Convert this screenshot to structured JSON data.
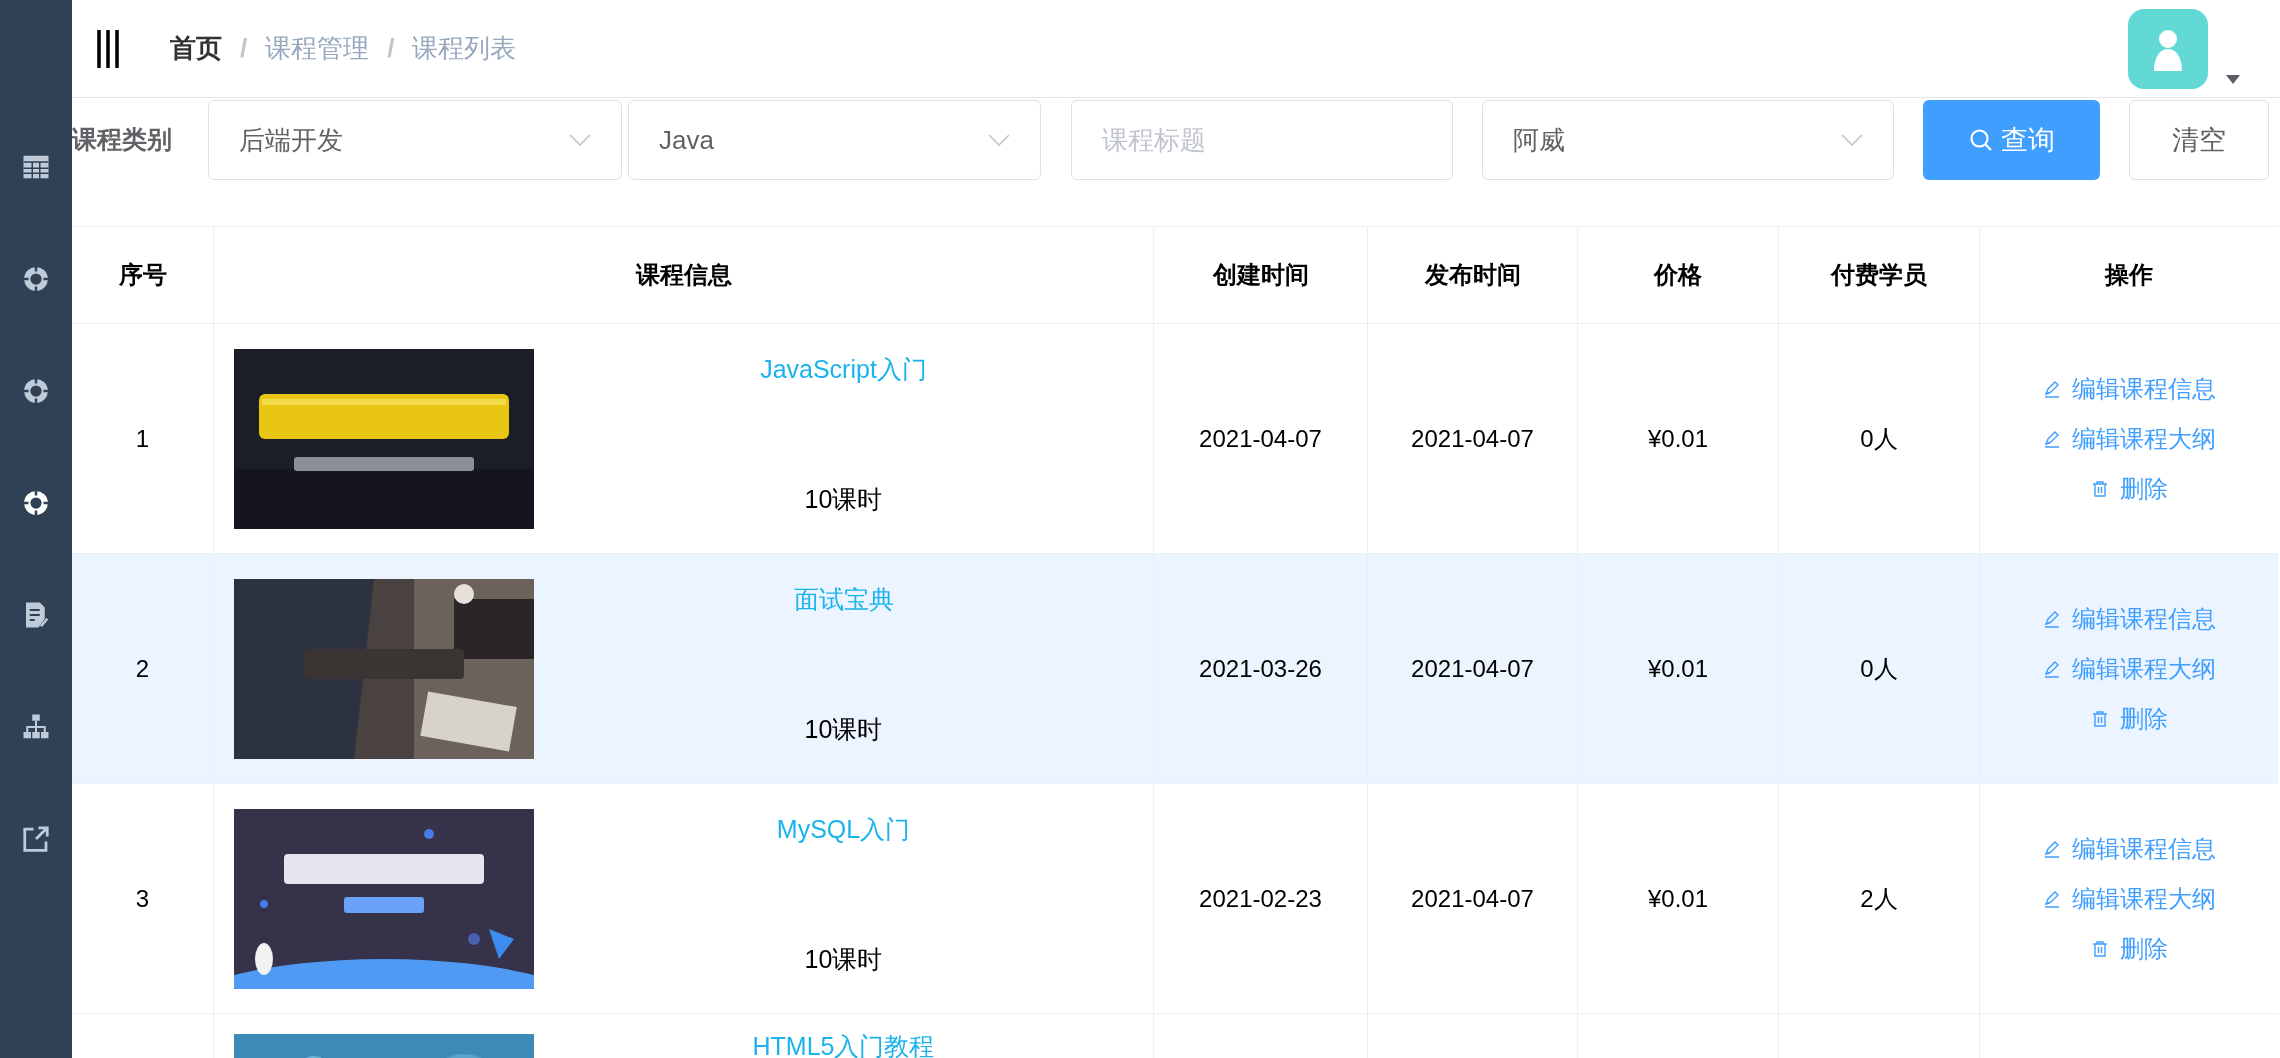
{
  "sidebar": {
    "items": [
      {
        "selected": false
      },
      {
        "selected": false
      },
      {
        "selected": false
      },
      {
        "selected": true
      },
      {
        "selected": false
      },
      {
        "selected": false
      },
      {
        "selected": false
      }
    ]
  },
  "breadcrumb": [
    {
      "label": "首页",
      "kind": "link"
    },
    {
      "separator": "/",
      "label": "课程管理",
      "kind": "text"
    },
    {
      "separator": "/",
      "label": "课程列表",
      "kind": "text"
    }
  ],
  "filters": {
    "label": "课程类别",
    "category": "后端开发",
    "subcategory": "Java",
    "title_placeholder": "课程标题",
    "teacher": "阿威",
    "search_button": "查询",
    "clear_button": "清空"
  },
  "table": {
    "columns": [
      "序号",
      "课程信息",
      "创建时间",
      "发布时间",
      "价格",
      "付费学员",
      "操作"
    ],
    "rows": [
      {
        "index": "1",
        "title": "JavaScript入门",
        "hours": "10课时",
        "created": "2021-04-07",
        "published": "2021-04-07",
        "price": "¥0.01",
        "students": "0人",
        "highlighted": false,
        "actions": [
          {
            "kind": "edit",
            "label": "编辑课程信息"
          },
          {
            "kind": "edit",
            "label": "编辑课程大纲"
          },
          {
            "kind": "delete",
            "label": "删除"
          }
        ]
      },
      {
        "index": "2",
        "title": "面试宝典",
        "hours": "10课时",
        "created": "2021-03-26",
        "published": "2021-04-07",
        "price": "¥0.01",
        "students": "0人",
        "highlighted": true,
        "actions": [
          {
            "kind": "edit",
            "label": "编辑课程信息"
          },
          {
            "kind": "edit",
            "label": "编辑课程大纲"
          },
          {
            "kind": "delete",
            "label": "删除"
          }
        ]
      },
      {
        "index": "3",
        "title": "MySQL入门",
        "hours": "10课时",
        "created": "2021-02-23",
        "published": "2021-04-07",
        "price": "¥0.01",
        "students": "2人",
        "highlighted": false,
        "actions": [
          {
            "kind": "edit",
            "label": "编辑课程信息"
          },
          {
            "kind": "edit",
            "label": "编辑课程大纲"
          },
          {
            "kind": "delete",
            "label": "删除"
          }
        ]
      },
      {
        "title": "HTML5入门教程",
        "highlighted": false
      }
    ]
  }
}
